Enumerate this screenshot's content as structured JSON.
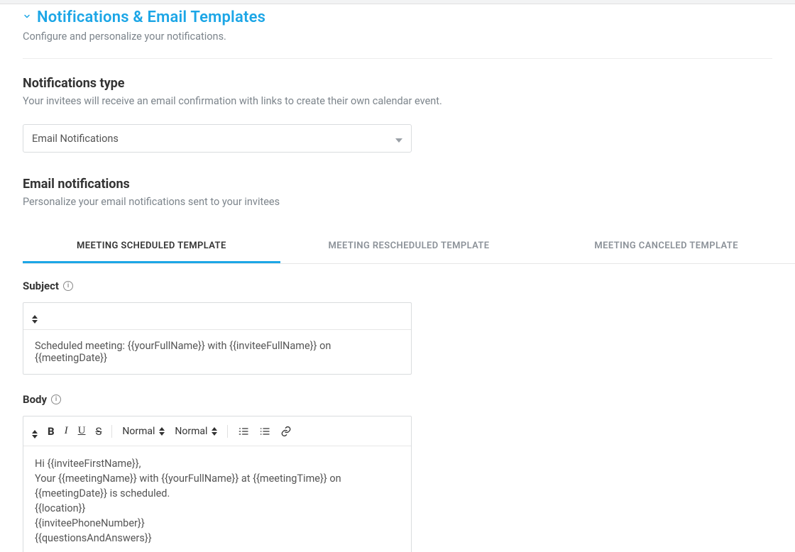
{
  "section": {
    "title": "Notifications & Email Templates",
    "subtitle": "Configure and personalize your notifications."
  },
  "notifications_type": {
    "heading": "Notifications type",
    "desc": "Your invitees will receive an email confirmation with links to create their own calendar event.",
    "selected": "Email Notifications"
  },
  "email_notifications": {
    "heading": "Email notifications",
    "desc": "Personalize your email notifications sent to your invitees"
  },
  "tabs": {
    "scheduled": "MEETING SCHEDULED TEMPLATE",
    "rescheduled": "MEETING RESCHEDULED TEMPLATE",
    "canceled": "MEETING CANCELED TEMPLATE"
  },
  "subject": {
    "label": "Subject",
    "value": "Scheduled meeting: {{yourFullName}} with {{inviteeFullName}} on {{meetingDate}}"
  },
  "body": {
    "label": "Body",
    "font_style": "Normal",
    "font_size": "Normal",
    "content": {
      "l1": "Hi {{inviteeFirstName}},",
      "l2": "Your {{meetingName}} with {{yourFullName}} at {{meetingTime}} on {{meetingDate}} is scheduled.",
      "l3": "{{location}}",
      "l4": "{{inviteePhoneNumber}}",
      "l5": "{{questionsAndAnswers}}"
    }
  },
  "glyphs": {
    "bold": "B",
    "italic": "I",
    "underline": "U",
    "strike": "S",
    "info": "i"
  }
}
